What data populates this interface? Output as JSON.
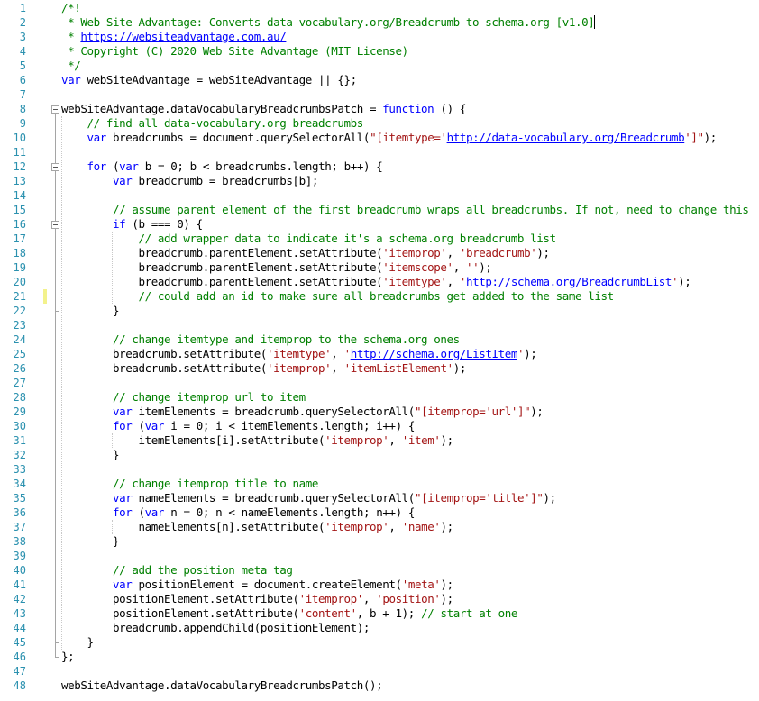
{
  "editor": {
    "line_numbers": [
      "1",
      "2",
      "3",
      "4",
      "5",
      "6",
      "7",
      "8",
      "9",
      "10",
      "11",
      "12",
      "13",
      "14",
      "15",
      "16",
      "17",
      "18",
      "19",
      "20",
      "21",
      "22",
      "23",
      "24",
      "25",
      "26",
      "27",
      "28",
      "29",
      "30",
      "31",
      "32",
      "33",
      "34",
      "35",
      "36",
      "37",
      "38",
      "39",
      "40",
      "41",
      "42",
      "43",
      "44",
      "45",
      "46",
      "47",
      "48"
    ],
    "changed_lines": [
      21
    ],
    "fold_lines": [
      8,
      12,
      16
    ],
    "cursor_line": 2,
    "colors": {
      "line_number": "#2b91af",
      "comment": "#008000",
      "keyword": "#0000ff",
      "string": "#a31515",
      "link": "#0000ff",
      "change_marker": "#f3f28c"
    },
    "lines": [
      [
        [
          "c",
          "/*!"
        ]
      ],
      [
        [
          "c",
          " * Web Site Advantage: Converts data-vocabulary.org/Breadcrumb to schema.org [v1.0]"
        ]
      ],
      [
        [
          "c",
          " * "
        ],
        [
          "u",
          "https://websiteadvantage.com.au/"
        ]
      ],
      [
        [
          "c",
          " * Copyright (C) 2020 Web Site Advantage (MIT License)"
        ]
      ],
      [
        [
          "c",
          " */"
        ]
      ],
      [
        [
          "k",
          "var"
        ],
        [
          "p",
          " webSiteAdvantage = webSiteAdvantage || {};"
        ]
      ],
      [],
      [
        [
          "p",
          "webSiteAdvantage.dataVocabularyBreadcrumbsPatch = "
        ],
        [
          "k",
          "function"
        ],
        [
          "p",
          " () {"
        ]
      ],
      [
        [
          "p",
          "    "
        ],
        [
          "c",
          "// find all data-vocabulary.org breadcrumbs"
        ]
      ],
      [
        [
          "p",
          "    "
        ],
        [
          "k",
          "var"
        ],
        [
          "p",
          " breadcrumbs = document.querySelectorAll("
        ],
        [
          "s",
          "\"[itemtype='"
        ],
        [
          "u",
          "http://data-vocabulary.org/Breadcrumb"
        ],
        [
          "s",
          "']\""
        ],
        [
          "p",
          ");"
        ]
      ],
      [],
      [
        [
          "p",
          "    "
        ],
        [
          "k",
          "for"
        ],
        [
          "p",
          " ("
        ],
        [
          "k",
          "var"
        ],
        [
          "p",
          " b = 0; b < breadcrumbs.length; b++) {"
        ]
      ],
      [
        [
          "p",
          "        "
        ],
        [
          "k",
          "var"
        ],
        [
          "p",
          " breadcrumb = breadcrumbs[b];"
        ]
      ],
      [],
      [
        [
          "p",
          "        "
        ],
        [
          "c",
          "// assume parent element of the first breadcrumb wraps all breadcrumbs. If not, need to change this"
        ]
      ],
      [
        [
          "p",
          "        "
        ],
        [
          "k",
          "if"
        ],
        [
          "p",
          " (b === 0) {"
        ]
      ],
      [
        [
          "p",
          "            "
        ],
        [
          "c",
          "// add wrapper data to indicate it's a schema.org breadcrumb list"
        ]
      ],
      [
        [
          "p",
          "            breadcrumb.parentElement.setAttribute("
        ],
        [
          "s",
          "'itemprop'"
        ],
        [
          "p",
          ", "
        ],
        [
          "s",
          "'breadcrumb'"
        ],
        [
          "p",
          ");"
        ]
      ],
      [
        [
          "p",
          "            breadcrumb.parentElement.setAttribute("
        ],
        [
          "s",
          "'itemscope'"
        ],
        [
          "p",
          ", "
        ],
        [
          "s",
          "''"
        ],
        [
          "p",
          ");"
        ]
      ],
      [
        [
          "p",
          "            breadcrumb.parentElement.setAttribute("
        ],
        [
          "s",
          "'itemtype'"
        ],
        [
          "p",
          ", "
        ],
        [
          "s",
          "'"
        ],
        [
          "u",
          "http://schema.org/BreadcrumbList"
        ],
        [
          "s",
          "'"
        ],
        [
          "p",
          ");"
        ]
      ],
      [
        [
          "p",
          "            "
        ],
        [
          "c",
          "// could add an id to make sure all breadcrumbs get added to the same list"
        ]
      ],
      [
        [
          "p",
          "        }"
        ]
      ],
      [],
      [
        [
          "p",
          "        "
        ],
        [
          "c",
          "// change itemtype and itemprop to the schema.org ones"
        ]
      ],
      [
        [
          "p",
          "        breadcrumb.setAttribute("
        ],
        [
          "s",
          "'itemtype'"
        ],
        [
          "p",
          ", "
        ],
        [
          "s",
          "'"
        ],
        [
          "u",
          "http://schema.org/ListItem"
        ],
        [
          "s",
          "'"
        ],
        [
          "p",
          ");"
        ]
      ],
      [
        [
          "p",
          "        breadcrumb.setAttribute("
        ],
        [
          "s",
          "'itemprop'"
        ],
        [
          "p",
          ", "
        ],
        [
          "s",
          "'itemListElement'"
        ],
        [
          "p",
          ");"
        ]
      ],
      [],
      [
        [
          "p",
          "        "
        ],
        [
          "c",
          "// change itemprop url to item"
        ]
      ],
      [
        [
          "p",
          "        "
        ],
        [
          "k",
          "var"
        ],
        [
          "p",
          " itemElements = breadcrumb.querySelectorAll("
        ],
        [
          "s",
          "\"[itemprop='url']\""
        ],
        [
          "p",
          ");"
        ]
      ],
      [
        [
          "p",
          "        "
        ],
        [
          "k",
          "for"
        ],
        [
          "p",
          " ("
        ],
        [
          "k",
          "var"
        ],
        [
          "p",
          " i = 0; i < itemElements.length; i++) {"
        ]
      ],
      [
        [
          "p",
          "            itemElements[i].setAttribute("
        ],
        [
          "s",
          "'itemprop'"
        ],
        [
          "p",
          ", "
        ],
        [
          "s",
          "'item'"
        ],
        [
          "p",
          ");"
        ]
      ],
      [
        [
          "p",
          "        }"
        ]
      ],
      [],
      [
        [
          "p",
          "        "
        ],
        [
          "c",
          "// change itemprop title to name"
        ]
      ],
      [
        [
          "p",
          "        "
        ],
        [
          "k",
          "var"
        ],
        [
          "p",
          " nameElements = breadcrumb.querySelectorAll("
        ],
        [
          "s",
          "\"[itemprop='title']\""
        ],
        [
          "p",
          ");"
        ]
      ],
      [
        [
          "p",
          "        "
        ],
        [
          "k",
          "for"
        ],
        [
          "p",
          " ("
        ],
        [
          "k",
          "var"
        ],
        [
          "p",
          " n = 0; n < nameElements.length; n++) {"
        ]
      ],
      [
        [
          "p",
          "            nameElements[n].setAttribute("
        ],
        [
          "s",
          "'itemprop'"
        ],
        [
          "p",
          ", "
        ],
        [
          "s",
          "'name'"
        ],
        [
          "p",
          ");"
        ]
      ],
      [
        [
          "p",
          "        }"
        ]
      ],
      [],
      [
        [
          "p",
          "        "
        ],
        [
          "c",
          "// add the position meta tag"
        ]
      ],
      [
        [
          "p",
          "        "
        ],
        [
          "k",
          "var"
        ],
        [
          "p",
          " positionElement = document.createElement("
        ],
        [
          "s",
          "'meta'"
        ],
        [
          "p",
          ");"
        ]
      ],
      [
        [
          "p",
          "        positionElement.setAttribute("
        ],
        [
          "s",
          "'itemprop'"
        ],
        [
          "p",
          ", "
        ],
        [
          "s",
          "'position'"
        ],
        [
          "p",
          ");"
        ]
      ],
      [
        [
          "p",
          "        positionElement.setAttribute("
        ],
        [
          "s",
          "'content'"
        ],
        [
          "p",
          ", b + 1); "
        ],
        [
          "c",
          "// start at one"
        ]
      ],
      [
        [
          "p",
          "        breadcrumb.appendChild(positionElement);"
        ]
      ],
      [
        [
          "p",
          "    }"
        ]
      ],
      [
        [
          "p",
          "};"
        ]
      ],
      [],
      [
        [
          "p",
          "webSiteAdvantage.dataVocabularyBreadcrumbsPatch();"
        ]
      ]
    ]
  }
}
